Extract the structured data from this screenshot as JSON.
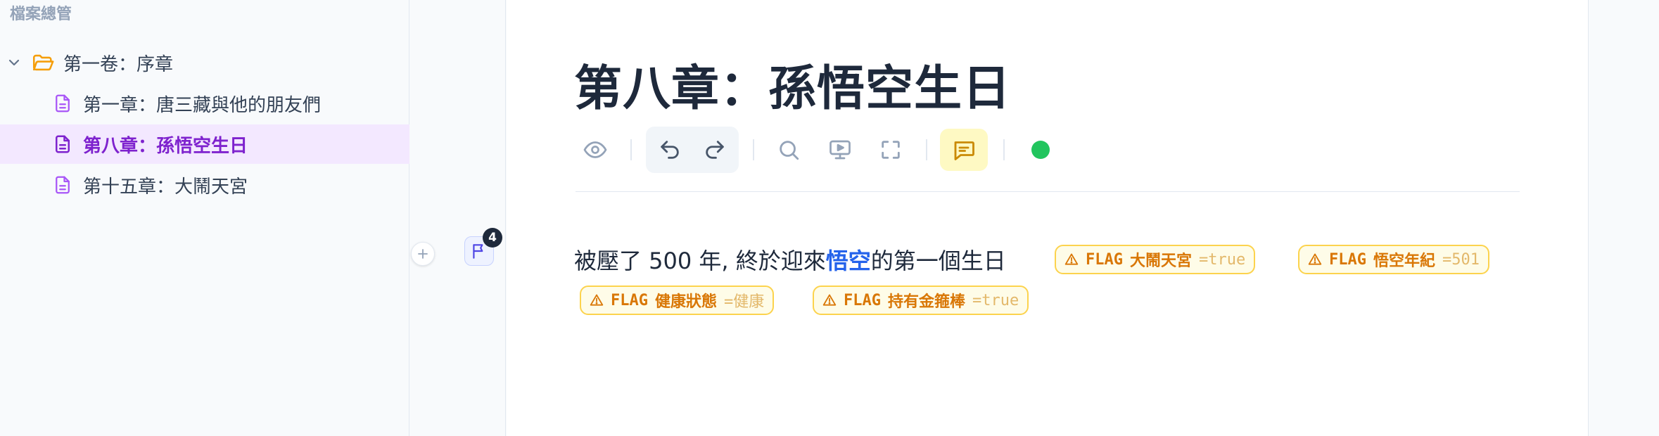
{
  "sidebar": {
    "title": "檔案總管",
    "volume": "第一卷：序章",
    "chapters": [
      {
        "label": "第一章：唐三藏與他的朋友們",
        "active": false
      },
      {
        "label": "第八章：孫悟空生日",
        "active": true
      },
      {
        "label": "第十五章：大鬧天宮",
        "active": false
      }
    ]
  },
  "gutter": {
    "flag_count": "4"
  },
  "editor": {
    "title": "第八章：孫悟空生日",
    "content": {
      "before": "被壓了 500 年, 終於迎來",
      "highlight": "悟空",
      "after": "的第一個生日"
    },
    "flags": [
      {
        "keyword": "FLAG",
        "name": "大鬧天宮",
        "value": "=true"
      },
      {
        "keyword": "FLAG",
        "name": "悟空年紀",
        "value": "=501"
      },
      {
        "keyword": "FLAG",
        "name": "健康狀態",
        "value": "=健康"
      },
      {
        "keyword": "FLAG",
        "name": "持有金箍棒",
        "value": "=true"
      }
    ],
    "toolbar": {
      "icons": [
        "eye-icon",
        "undo-icon",
        "redo-icon",
        "search-icon",
        "present-icon",
        "fullscreen-icon",
        "comment-icon"
      ],
      "status_color": "#22c55e"
    }
  },
  "colors": {
    "accent": "#7e22ce",
    "active_bg": "#f3e8ff",
    "folder": "#f59e0b",
    "doc_icon": "#a855f7",
    "flag_text": "#d97706",
    "link": "#2563eb"
  }
}
